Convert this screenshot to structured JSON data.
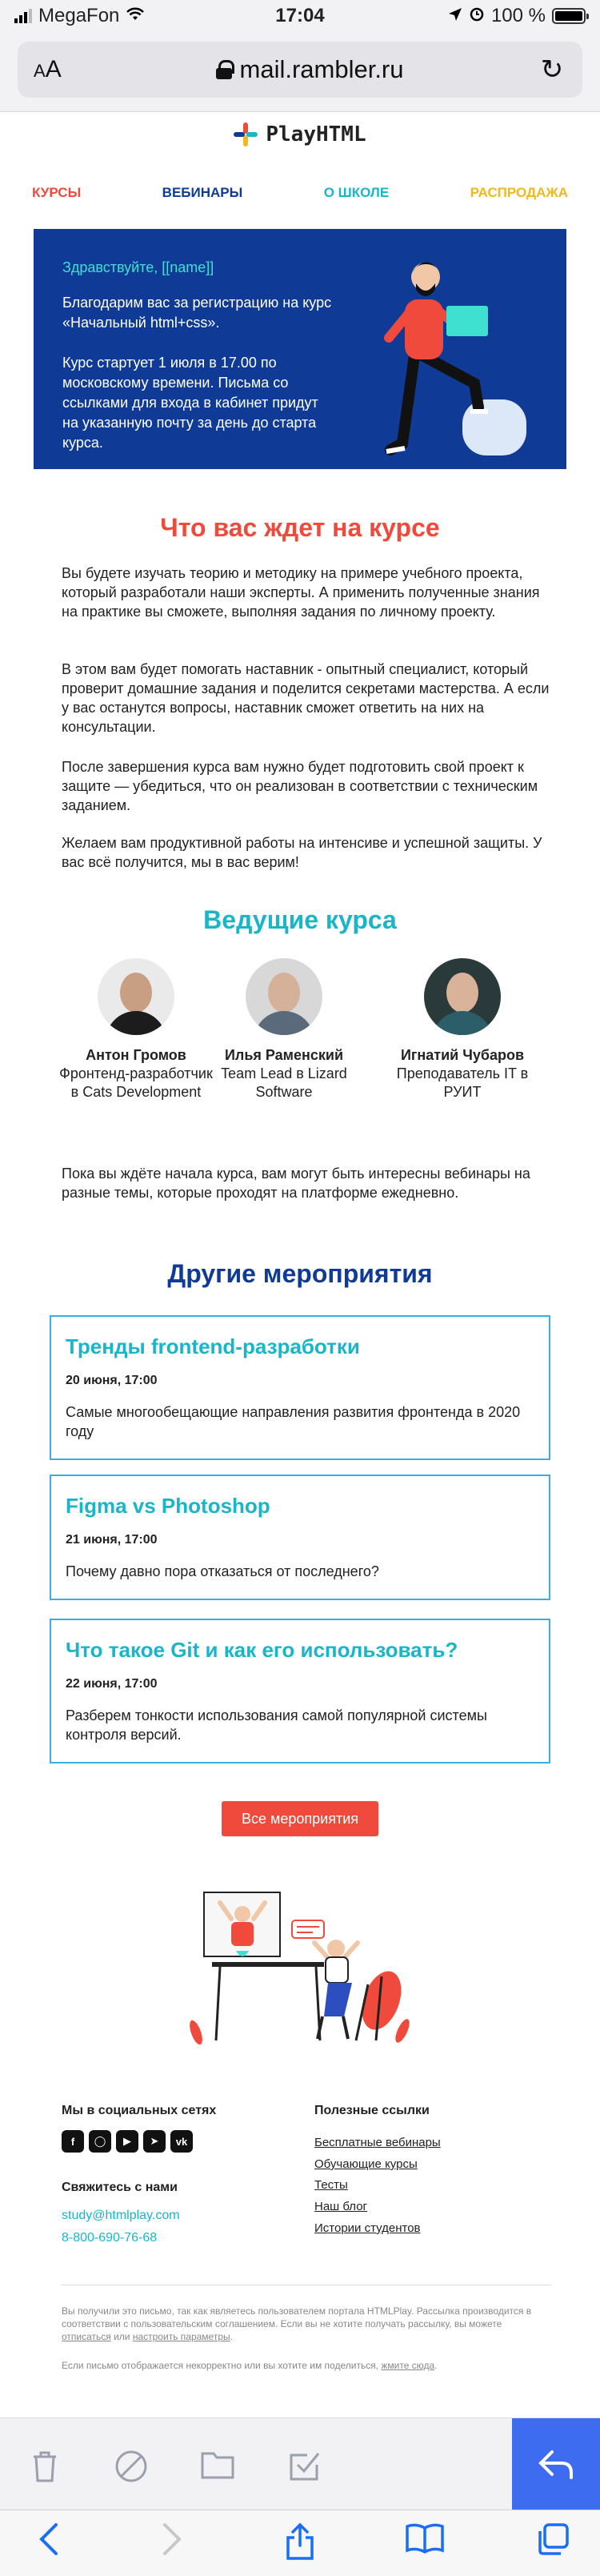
{
  "status_bar": {
    "carrier": "MegaFon",
    "time": "17:04",
    "battery": "100 %",
    "battery_level": 1.0,
    "signal_bars": 3,
    "signal_total": 4
  },
  "browser": {
    "text_size": "AA",
    "url": "mail.rambler.ru"
  },
  "email": {
    "logo_text": "PlayHTML",
    "menu": [
      {
        "label": "Курсы",
        "color": "#ef4a3c"
      },
      {
        "label": "Вебинары",
        "color": "#0f3b97"
      },
      {
        "label": "О школе",
        "color": "#18b6c8"
      },
      {
        "label": "Распродажа",
        "color": "#f2b81c"
      }
    ],
    "hero": {
      "greeting": "Здравствуйте, [[name]]",
      "line1": "Благодарим вас за регистрацию на курс «Начальный html+css».",
      "line2": "Курс стартует 1 июля в 17.00 по московскому времени. Письма со ссылками для входа в кабинет придут на указанную почту за день до старта курса."
    },
    "about": {
      "title": "Что вас ждет на курсе",
      "paragraphs": [
        "Вы будете изучать теорию и методику на примере учебного проекта, который разработали наши эксперты. А применить полученные знания на практике вы сможете, выполняя задания по личному проекту.",
        "В этом вам будет помогать наставник - опытный специалист, который проверит домашние задания и поделится секретами мастерства. А если у вас останутся вопросы, наставник сможет ответить на них на консультации.",
        "После завершения курса вам нужно будет подготовить свой проект к защите — убедиться, что он реализован в соответствии с техническим заданием.",
        "Желаем вам продуктивной работы на интенсиве и успешной защиты. У вас всё получится, мы в вас верим!"
      ]
    },
    "teachers": {
      "title": "Ведущие курса",
      "items": [
        {
          "name": "Антон Громов",
          "role": "Фронтенд-разработчик в Cats Development"
        },
        {
          "name": "Илья Раменский",
          "role": "Team Lead в Lizard Software"
        },
        {
          "name": "Игнатий Чубаров",
          "role": "Преподаватель IT в РУИТ"
        }
      ],
      "note": "Пока вы ждёте начала курса, вам могут быть интересны вебинары на разные темы, которые проходят на платформе ежедневно."
    },
    "events": {
      "title": "Другие мероприятия",
      "items": [
        {
          "title": "Тренды frontend-разработки",
          "date": "20 июня, 17:00",
          "desc": "Самые многообещающие направления развития фронтенда в 2020 году"
        },
        {
          "title": "Figma vs Photoshop",
          "date": "21 июня, 17:00",
          "desc": "Почему давно пора отказаться от последнего?"
        },
        {
          "title": "Что такое Git и как его использовать?",
          "date": "22 июня, 17:00",
          "desc": "Разберем тонкости использования самой популярной системы контроля версий."
        }
      ],
      "button": "Все мероприятия"
    },
    "footer": {
      "social_title": "Мы в социальных сетях",
      "social_icons": [
        "facebook-icon",
        "instagram-icon",
        "youtube-icon",
        "telegram-icon",
        "vk-icon"
      ],
      "contact_title": "Свяжитесь с нами",
      "email": "study@htmlplay.com",
      "phone": "8-800-690-76-68",
      "useful_title": "Полезные ссылки",
      "useful_links": [
        "Бесплатные вебинары",
        "Обучающие курсы",
        "Тесты",
        "Наш блог",
        "Истории студентов"
      ],
      "legal_1_a": "Вы получили это письмо, так как являетесь пользователем портала HTMLPlay. Рассылка производится в соответствии с пользовательским соглашением. Если вы не хотите получать рассылку, вы можете ",
      "legal_1_unsub": "отписаться",
      "legal_1_b": " или ",
      "legal_1_settings": "настроить параметры",
      "legal_1_c": ".",
      "legal_2_a": "Если письмо отображается некорректно или вы хотите им поделиться, ",
      "legal_2_link": "жмите сюда",
      "legal_2_b": "."
    }
  },
  "colors": {
    "accent_red": "#ef4a3c",
    "accent_blue": "#0f3b97",
    "accent_teal": "#18b6c8",
    "ios_blue": "#1a6ef5"
  }
}
